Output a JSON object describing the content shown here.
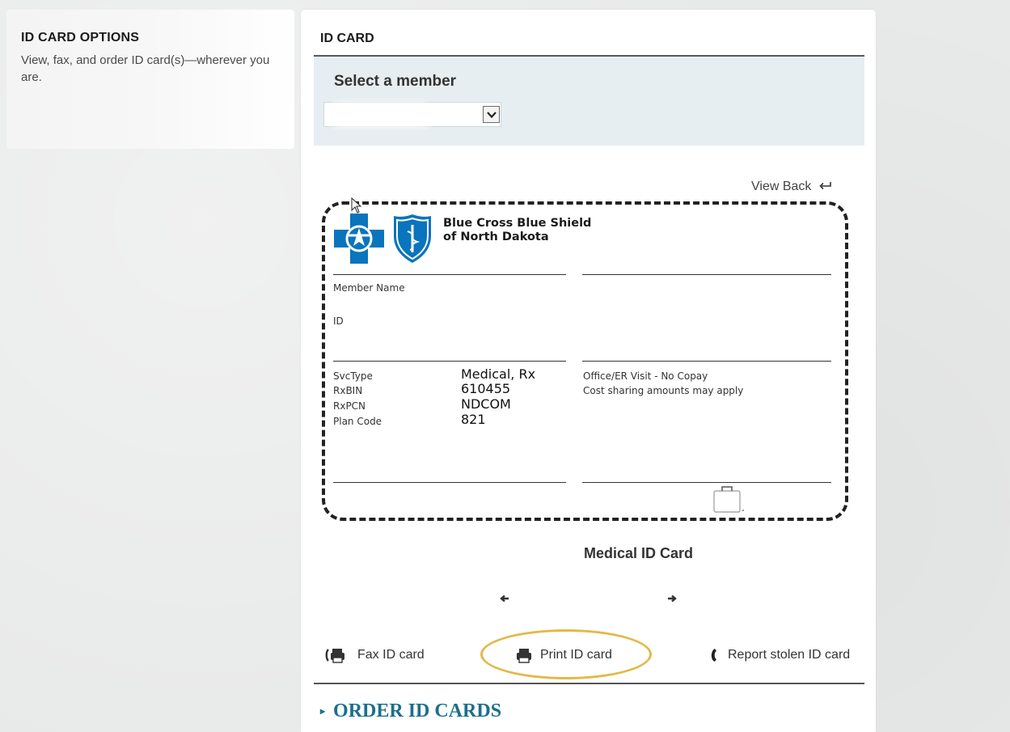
{
  "sidebar": {
    "title": "ID CARD OPTIONS",
    "description": "View, fax, and order ID card(s)—wherever you are."
  },
  "panel": {
    "title": "ID CARD",
    "member_select_label": "Select a member",
    "member_select_value": ""
  },
  "card": {
    "view_back_label": "View Back",
    "company_line1": "Blue Cross Blue Shield",
    "company_line2": "of North Dakota",
    "member_name_label": "Member Name",
    "id_label": "ID",
    "svc_type_label": "SvcType",
    "svc_type_value": "Medical, Rx",
    "rxbin_label": "RxBIN",
    "rxbin_value": "610455",
    "rxpcn_label": "RxPCN",
    "rxpcn_value": "NDCOM",
    "plan_code_label": "Plan Code",
    "plan_code_value": "821",
    "office_visit": "Office/ER Visit - No Copay",
    "cost_sharing": "Cost sharing amounts may apply",
    "caption": "Medical ID Card"
  },
  "actions": {
    "fax_label": "Fax ID card",
    "print_label": "Print ID card",
    "report_label": "Report stolen ID card"
  },
  "order_link": "ORDER ID CARDS",
  "colors": {
    "brand_blue": "#0a74bd",
    "link_teal": "#1b6f8c",
    "highlight": "#e2b94a"
  }
}
